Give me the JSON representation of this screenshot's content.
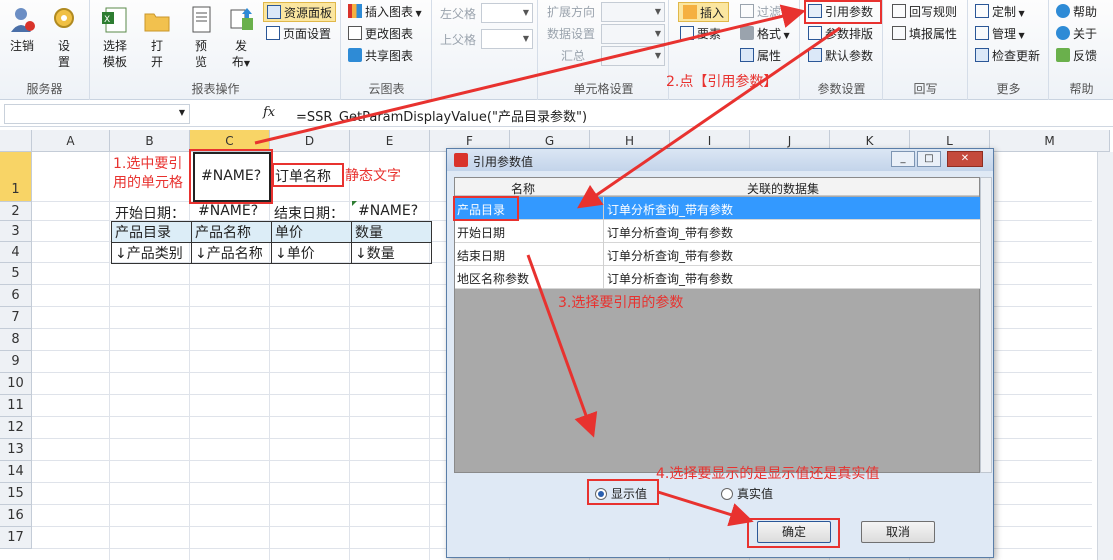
{
  "ribbon": {
    "groups": {
      "server": {
        "label": "服务器",
        "login": "注销",
        "settings_line1": "设",
        "settings_line2": "置"
      },
      "report_ops": {
        "label": "报表操作",
        "select_template_line1": "选择",
        "select_template_line2": "模板",
        "open_line1": "打",
        "open_line2": "开",
        "preview_line1": "预",
        "preview_line2": "览",
        "publish_line1": "发",
        "publish_line2": "布"
      },
      "resource": {
        "resource_panel": "资源面板",
        "page_setup": "页面设置"
      },
      "cloud_chart": {
        "label": "云图表",
        "insert_chart": "插入图表",
        "change_chart": "更改图表",
        "share_chart": "共享图表"
      },
      "parent": {
        "left_parent": "左父格",
        "top_parent": "上父格"
      },
      "cell_settings": {
        "label": "单元格设置",
        "expand_dir": "扩展方向",
        "data_setting": "数据设置",
        "summary": "汇总"
      },
      "insert": {
        "insert": "插入",
        "format": "格式",
        "filter": "过滤",
        "attr": "属性",
        "extra": "要素"
      },
      "param": {
        "label": "参数设置",
        "ref_param": "引用参数",
        "param_layout": "参数排版",
        "default_param": "默认参数"
      },
      "writeback": {
        "label": "回写",
        "writeback_rule": "回写规则",
        "fill_attr": "填报属性"
      },
      "more": {
        "label": "更多",
        "custom": "定制",
        "manage": "管理",
        "check_update": "检查更新"
      },
      "help": {
        "label": "帮助",
        "help": "帮助",
        "about": "关于",
        "feedback": "反馈"
      }
    }
  },
  "formula_bar": {
    "fx": "fx",
    "formula": "=SSR_GetParamDisplayValue(\"产品目录参数\")"
  },
  "sheet": {
    "columns": [
      "A",
      "B",
      "C",
      "D",
      "E",
      "F",
      "G",
      "H",
      "I",
      "J",
      "K",
      "L",
      "M"
    ],
    "rows": [
      "1",
      "2",
      "3",
      "4",
      "5",
      "6",
      "7",
      "8",
      "9",
      "10",
      "11",
      "12",
      "13",
      "14",
      "15",
      "16",
      "17"
    ],
    "cells": {
      "c1": "#NAME?",
      "d1": "订单名称",
      "b2": "开始日期：",
      "c2": "#NAME?",
      "d2": "结束日期：",
      "e2": "#NAME?",
      "b3": "产品目录",
      "c3": "产品名称",
      "d3": "单价",
      "e3": "数量",
      "b4": "↓产品类别",
      "c4": "↓产品名称",
      "d4": "↓单价",
      "e4": "↓数量"
    }
  },
  "annotations": {
    "step1_line1": "1.选中要引",
    "step1_line2": "用的单元格",
    "static_text": "静态文字",
    "step2": "2.点【引用参数】",
    "step3": "3.选择要引用的参数",
    "step4": "4.选择要显示的是显示值还是真实值"
  },
  "dialog": {
    "title": "引用参数值",
    "col_name": "名称",
    "col_dataset": "关联的数据集",
    "rows": [
      {
        "name": "产品目录",
        "dataset": "订单分析查询_带有参数"
      },
      {
        "name": "开始日期",
        "dataset": "订单分析查询_带有参数"
      },
      {
        "name": "结束日期",
        "dataset": "订单分析查询_带有参数"
      },
      {
        "name": "地区名称参数",
        "dataset": "订单分析查询_带有参数"
      }
    ],
    "radio_display": "显示值",
    "radio_real": "真实值",
    "ok": "确定",
    "cancel": "取消"
  },
  "colors": {
    "accent_red": "#e8322f",
    "selection_blue": "#3399ff",
    "header_highlight": "#f8d466"
  }
}
